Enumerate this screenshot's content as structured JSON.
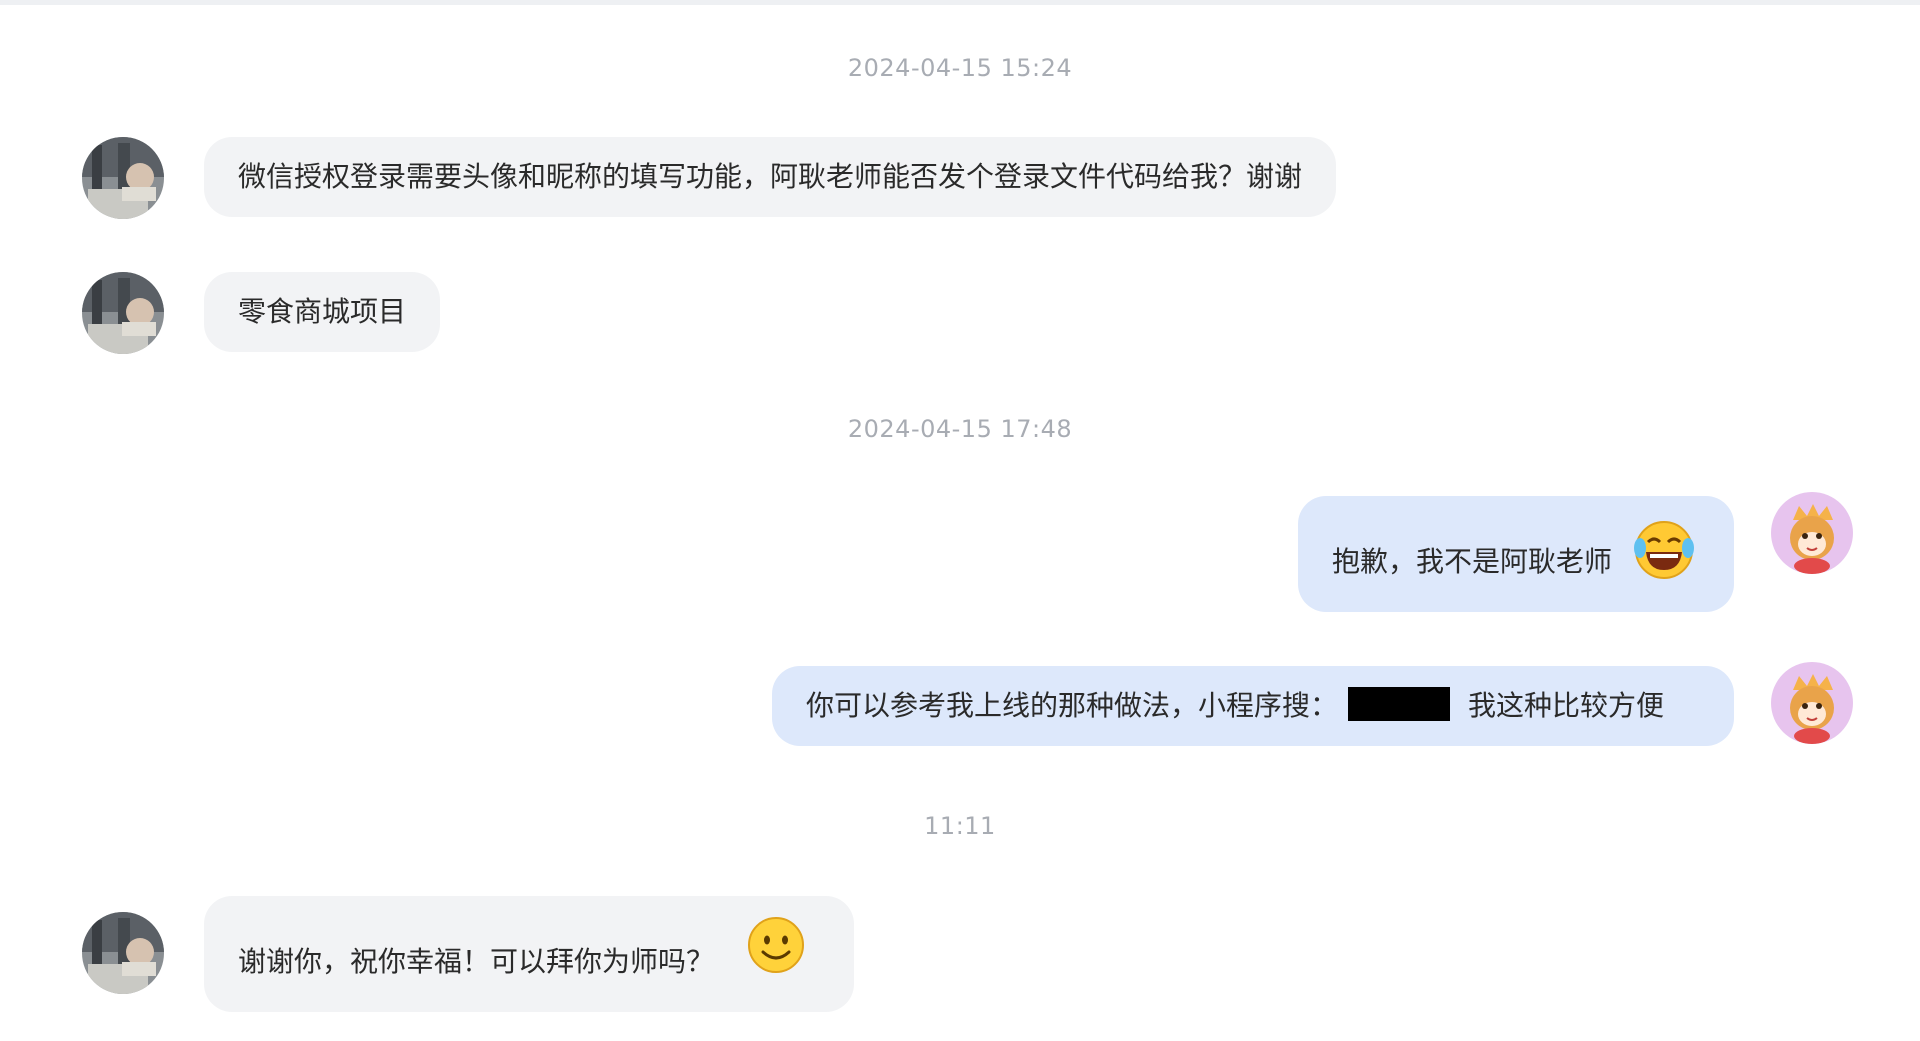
{
  "chat": {
    "timestamps": [
      "2024-04-15  15:24",
      "2024-04-15  17:48",
      "11:11"
    ],
    "messages": [
      {
        "side": "left",
        "text": "微信授权登录需要头像和昵称的填写功能，阿耿老师能否发个登录文件代码给我？谢谢"
      },
      {
        "side": "left",
        "text": "零食商城项目"
      },
      {
        "side": "right",
        "text": "抱歉，我不是阿耿老师",
        "emoji": "laughing-tears-emoji"
      },
      {
        "side": "right",
        "text_before": "你可以参考我上线的那种做法，小程序搜：",
        "text_after": "我这种比较方便",
        "redacted": "redaction-bar"
      },
      {
        "side": "left",
        "text": "谢谢你，祝你幸福！可以拜你为师吗？",
        "emoji": "smile-emoji"
      }
    ]
  },
  "colors": {
    "left_bubble": "#f2f3f5",
    "right_bubble": "#dde8fb",
    "timestamp": "#a8acb3",
    "right_avatar_bg": "#e7c4ee"
  }
}
